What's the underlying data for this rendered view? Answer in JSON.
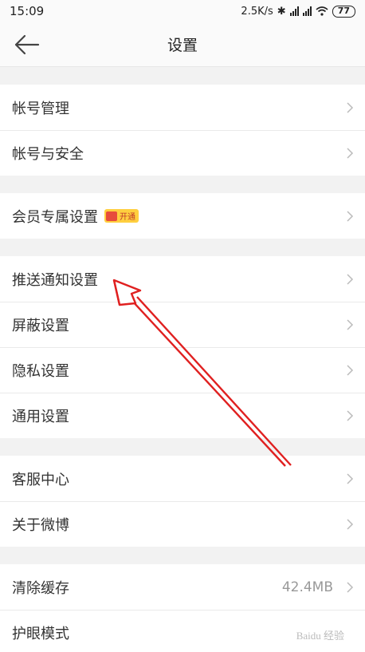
{
  "status": {
    "time": "15:09",
    "speed": "2.5K/s",
    "battery": "77"
  },
  "header": {
    "title": "设置"
  },
  "groups": [
    {
      "rows": [
        {
          "label": "帐号管理"
        },
        {
          "label": "帐号与安全"
        }
      ]
    },
    {
      "rows": [
        {
          "label": "会员专属设置",
          "badge": "开通"
        }
      ]
    },
    {
      "rows": [
        {
          "label": "推送通知设置"
        },
        {
          "label": "屏蔽设置"
        },
        {
          "label": "隐私设置"
        },
        {
          "label": "通用设置"
        }
      ]
    },
    {
      "rows": [
        {
          "label": "客服中心"
        },
        {
          "label": "关于微博"
        }
      ]
    },
    {
      "rows": [
        {
          "label": "清除缓存",
          "value": "42.4MB"
        },
        {
          "label": "护眼模式"
        }
      ]
    }
  ],
  "watermark": "Baidu 经验",
  "colors": {
    "arrow": "#e02020",
    "badge": "#ffcf3f"
  }
}
